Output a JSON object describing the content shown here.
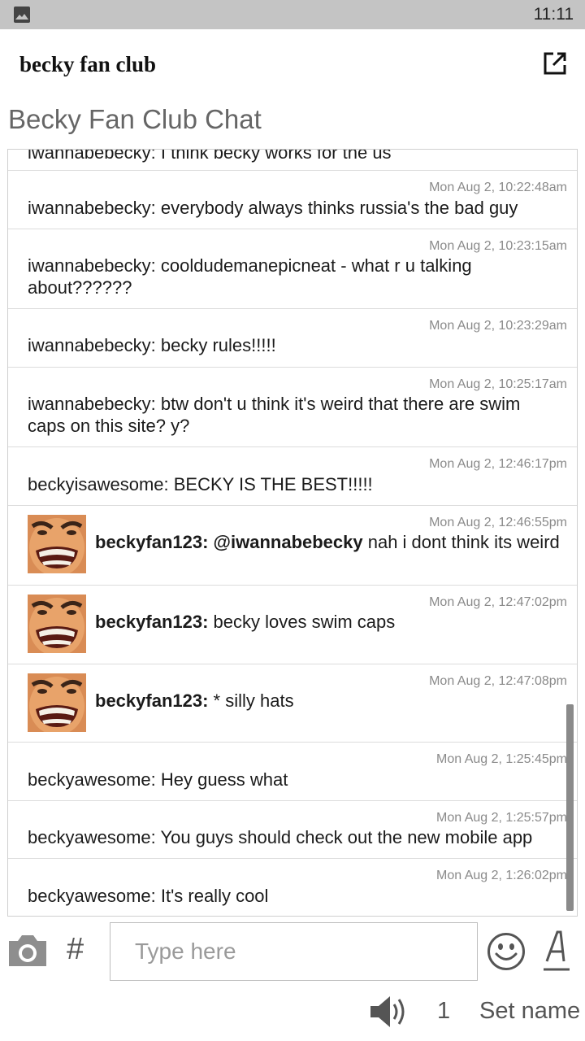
{
  "status_bar": {
    "time": "11:11"
  },
  "app_bar": {
    "title": "becky fan club"
  },
  "chat": {
    "title": "Becky Fan Club Chat",
    "partial_message": "iwannabebecky: I think becky works for the us",
    "messages": [
      {
        "time": "Mon Aug 2, 10:22:48am",
        "text": "iwannabebecky: everybody always thinks russia's the bad guy"
      },
      {
        "time": "Mon Aug 2, 10:23:15am",
        "text": "iwannabebecky: cooldudemanepicneat - what r u talking about??????"
      },
      {
        "time": "Mon Aug 2, 10:23:29am",
        "text": "iwannabebecky: becky rules!!!!!"
      },
      {
        "time": "Mon Aug 2, 10:25:17am",
        "text": "iwannabebecky: btw don't u think it's weird that there are swim caps on this site? y?"
      },
      {
        "time": "Mon Aug 2, 12:46:17pm",
        "text": "beckyisawesome: BECKY IS THE BEST!!!!!"
      },
      {
        "time": "Mon Aug 2, 12:46:55pm",
        "user": "beckyfan123:",
        "mention": "@iwannabebecky",
        "text": " nah i dont think its weird"
      },
      {
        "time": "Mon Aug 2, 12:47:02pm",
        "user": "beckyfan123:",
        "text": " becky loves swim caps"
      },
      {
        "time": "Mon Aug 2, 12:47:08pm",
        "user": "beckyfan123:",
        "text": " * silly hats"
      },
      {
        "time": "Mon Aug 2, 1:25:45pm",
        "text": "beckyawesome: Hey guess what"
      },
      {
        "time": "Mon Aug 2, 1:25:57pm",
        "text": "beckyawesome: You guys should check out the new mobile app"
      },
      {
        "time": "Mon Aug 2, 1:26:02pm",
        "text": "beckyawesome: It's really cool"
      }
    ]
  },
  "composer": {
    "placeholder": "Type here",
    "hash": "#"
  },
  "footer": {
    "user_count": "1",
    "set_name": "Set name"
  },
  "icons": {
    "status": "image-icon",
    "app_bar": "open-external-icon",
    "composer": [
      "camera-icon",
      "hash-icon",
      "smiley-icon",
      "text-format-icon"
    ],
    "footer": "speaker-icon"
  }
}
